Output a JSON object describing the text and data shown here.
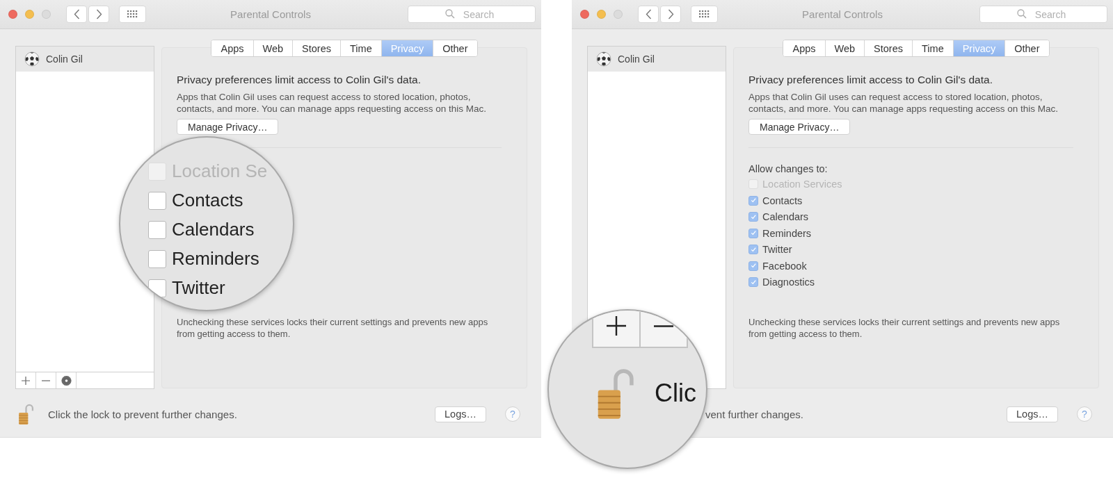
{
  "windows": [
    {
      "title": "Parental Controls",
      "search": {
        "placeholder": "Search"
      },
      "users": [
        {
          "name": "Colin Gil",
          "selected": true
        }
      ],
      "toolbar_visible": true,
      "tabs": [
        {
          "label": "Apps",
          "selected": false
        },
        {
          "label": "Web",
          "selected": false
        },
        {
          "label": "Stores",
          "selected": false
        },
        {
          "label": "Time",
          "selected": false
        },
        {
          "label": "Privacy",
          "selected": true
        },
        {
          "label": "Other",
          "selected": false
        }
      ],
      "heading": "Privacy preferences limit access to Colin Gil's data.",
      "description": "Apps that Colin Gil uses can request access to stored location, photos, contacts, and more. You can manage apps requesting access on this Mac.",
      "manage_button": "Manage Privacy…",
      "footnote": "Unchecking these services locks their current settings and prevents new apps from getting access to them.",
      "status": {
        "text": "Click the lock to prevent further changes.",
        "lock_visible": true
      },
      "logs_button": "Logs…",
      "help_button": "?"
    },
    {
      "title": "Parental Controls",
      "search": {
        "placeholder": "Search"
      },
      "users": [
        {
          "name": "Colin Gil",
          "selected": true
        }
      ],
      "toolbar_visible": false,
      "tabs": [
        {
          "label": "Apps",
          "selected": false
        },
        {
          "label": "Web",
          "selected": false
        },
        {
          "label": "Stores",
          "selected": false
        },
        {
          "label": "Time",
          "selected": false
        },
        {
          "label": "Privacy",
          "selected": true
        },
        {
          "label": "Other",
          "selected": false
        }
      ],
      "heading": "Privacy preferences limit access to Colin Gil's data.",
      "description": "Apps that Colin Gil uses can request access to stored location, photos, contacts, and more. You can manage apps requesting access on this Mac.",
      "manage_button": "Manage Privacy…",
      "allow_label": "Allow changes to:",
      "services": [
        {
          "label": "Location Services",
          "checked": false,
          "disabled": true
        },
        {
          "label": "Contacts",
          "checked": true,
          "disabled": false
        },
        {
          "label": "Calendars",
          "checked": true,
          "disabled": false
        },
        {
          "label": "Reminders",
          "checked": true,
          "disabled": false
        },
        {
          "label": "Twitter",
          "checked": true,
          "disabled": false
        },
        {
          "label": "Facebook",
          "checked": true,
          "disabled": false
        },
        {
          "label": "Diagnostics",
          "checked": true,
          "disabled": false
        }
      ],
      "footnote": "Unchecking these services locks their current settings and prevents new apps from getting access to them.",
      "status": {
        "text": "vent further changes.",
        "lock_visible": false
      },
      "logs_button": "Logs…",
      "help_button": "?"
    }
  ],
  "magnifiers": [
    {
      "kind": "services",
      "rows": [
        {
          "label": "Location Se",
          "checked": false,
          "disabled": true
        },
        {
          "label": "Contacts",
          "checked": false,
          "disabled": false
        },
        {
          "label": "Calendars",
          "checked": false,
          "disabled": false
        },
        {
          "label": "Reminders",
          "checked": false,
          "disabled": false
        },
        {
          "label": "Twitter",
          "checked": false,
          "disabled": false
        }
      ]
    },
    {
      "kind": "toolbar",
      "text": "Clic"
    }
  ]
}
